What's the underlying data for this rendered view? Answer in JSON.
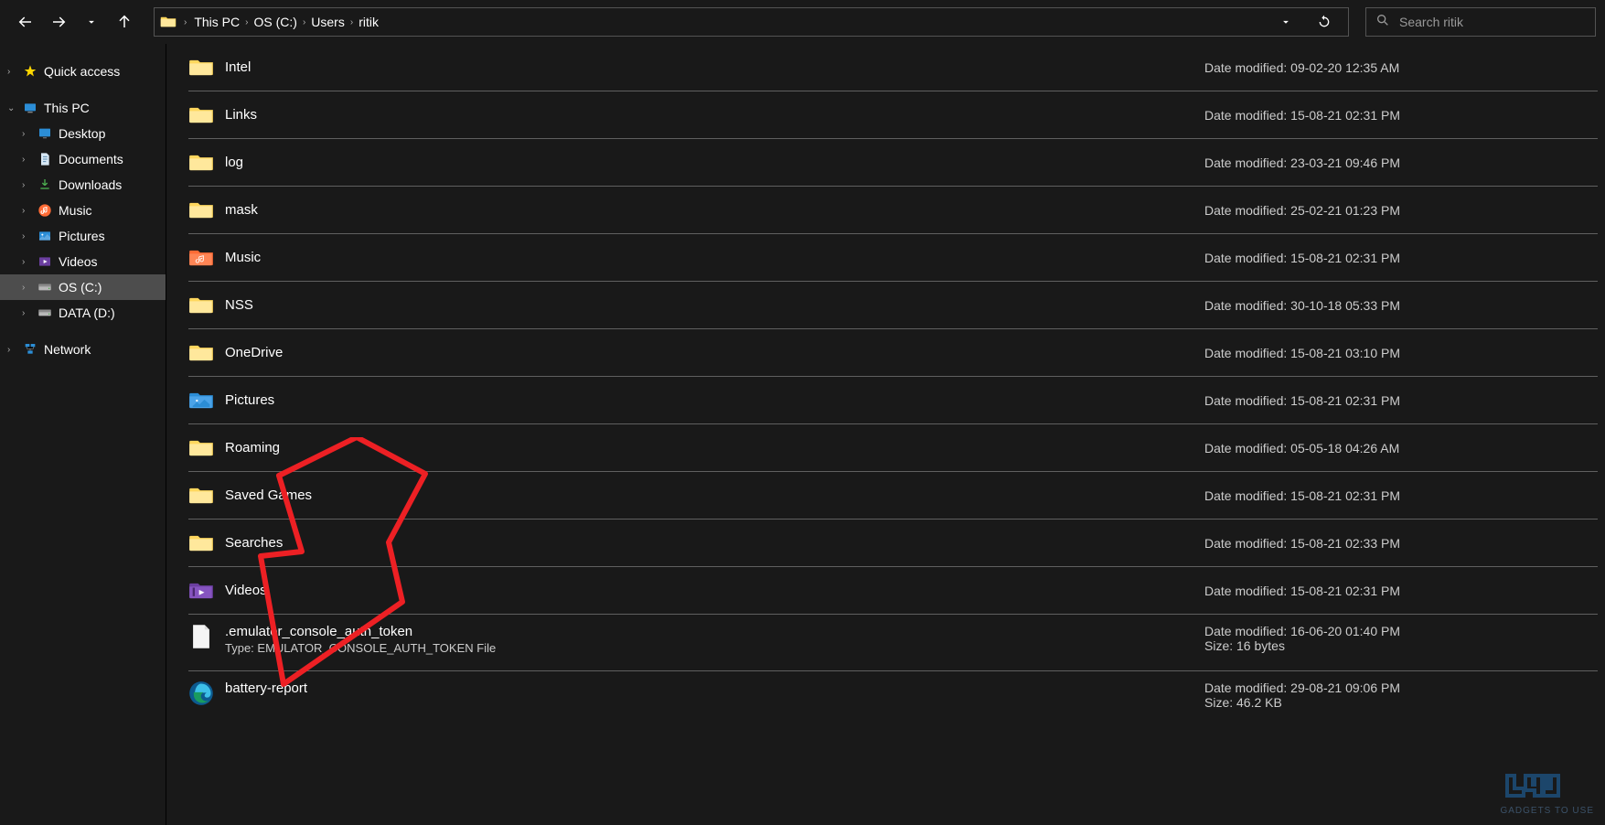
{
  "breadcrumb": [
    "This PC",
    "OS (C:)",
    "Users",
    "ritik"
  ],
  "search": {
    "placeholder": "Search ritik"
  },
  "sidebar": [
    {
      "chevron": "›",
      "icon": "star",
      "label": "Quick access",
      "level": 0
    },
    {
      "chevron": "⌄",
      "icon": "pc",
      "label": "This PC",
      "level": 0
    },
    {
      "chevron": "›",
      "icon": "desktop",
      "label": "Desktop",
      "level": 1
    },
    {
      "chevron": "›",
      "icon": "documents",
      "label": "Documents",
      "level": 1
    },
    {
      "chevron": "›",
      "icon": "downloads",
      "label": "Downloads",
      "level": 1
    },
    {
      "chevron": "›",
      "icon": "music",
      "label": "Music",
      "level": 1
    },
    {
      "chevron": "›",
      "icon": "pictures",
      "label": "Pictures",
      "level": 1
    },
    {
      "chevron": "›",
      "icon": "videos",
      "label": "Videos",
      "level": 1
    },
    {
      "chevron": "›",
      "icon": "drive",
      "label": "OS (C:)",
      "level": 1,
      "selected": true
    },
    {
      "chevron": "›",
      "icon": "drive",
      "label": "DATA (D:)",
      "level": 1
    },
    {
      "chevron": "›",
      "icon": "network",
      "label": "Network",
      "level": 0
    }
  ],
  "files": [
    {
      "icon": "folder",
      "name": "Intel",
      "modified": "Date modified: 09-02-20 12:35 AM"
    },
    {
      "icon": "folder",
      "name": "Links",
      "modified": "Date modified: 15-08-21 02:31 PM"
    },
    {
      "icon": "folder",
      "name": "log",
      "modified": "Date modified: 23-03-21 09:46 PM"
    },
    {
      "icon": "folder",
      "name": "mask",
      "modified": "Date modified: 25-02-21 01:23 PM"
    },
    {
      "icon": "music-folder",
      "name": "Music",
      "modified": "Date modified: 15-08-21 02:31 PM"
    },
    {
      "icon": "folder",
      "name": "NSS",
      "modified": "Date modified: 30-10-18 05:33 PM"
    },
    {
      "icon": "folder",
      "name": "OneDrive",
      "modified": "Date modified: 15-08-21 03:10 PM"
    },
    {
      "icon": "pictures-folder",
      "name": "Pictures",
      "modified": "Date modified: 15-08-21 02:31 PM"
    },
    {
      "icon": "folder",
      "name": "Roaming",
      "modified": "Date modified: 05-05-18 04:26 AM"
    },
    {
      "icon": "folder",
      "name": "Saved Games",
      "modified": "Date modified: 15-08-21 02:31 PM"
    },
    {
      "icon": "folder",
      "name": "Searches",
      "modified": "Date modified: 15-08-21 02:33 PM"
    },
    {
      "icon": "videos-folder",
      "name": "Videos",
      "modified": "Date modified: 15-08-21 02:31 PM"
    },
    {
      "icon": "file",
      "name": ".emulator_console_auth_token",
      "type": "Type: EMULATOR_CONSOLE_AUTH_TOKEN File",
      "modified": "Date modified: 16-06-20 01:40 PM",
      "size": "Size: 16 bytes"
    },
    {
      "icon": "edge",
      "name": "battery-report",
      "modified": "Date modified: 29-08-21 09:06 PM",
      "size": "Size: 46.2 KB"
    }
  ],
  "watermark": "GADGETS TO USE"
}
